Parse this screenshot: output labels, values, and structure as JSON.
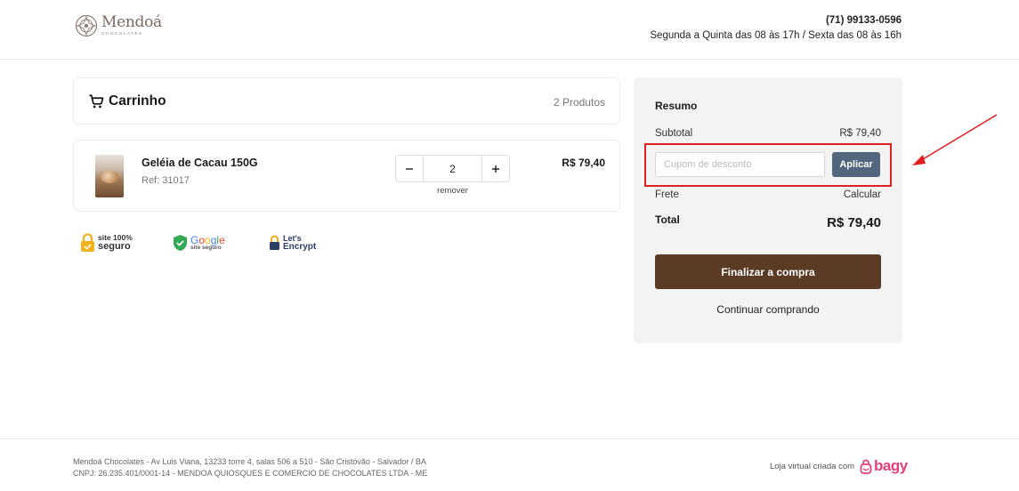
{
  "header": {
    "logo_name": "Mendoá",
    "logo_sub": "CHOCOLATES",
    "phone": "(71) 99133-0596",
    "hours": "Segunda a Quinta das 08 às 17h / Sexta das 08 às 16h"
  },
  "cart": {
    "title": "Carrinho",
    "count": "2 Produtos",
    "items": [
      {
        "name": "Geléia de Cacau 150G",
        "ref": "Ref: 31017",
        "quantity": "2",
        "remove_label": "remover",
        "price": "R$ 79,40"
      }
    ],
    "seals": [
      {
        "line1": "site 100%",
        "line2": "seguro"
      },
      {
        "line1": "Google",
        "line2": "site seguro"
      },
      {
        "line1": "Let's",
        "line2": "Encrypt"
      }
    ]
  },
  "summary": {
    "title": "Resumo",
    "subtotal_label": "Subtotal",
    "subtotal_value": "R$ 79,40",
    "coupon_placeholder": "Cupom de desconto",
    "apply_label": "Aplicar",
    "shipping_label": "Frete",
    "shipping_action": "Calcular",
    "total_label": "Total",
    "total_value": "R$ 79,40",
    "checkout_label": "Finalizar a compra",
    "continue_label": "Continuar comprando"
  },
  "footer": {
    "address": "Mendoá Chocolates - Av Luis Viana, 13233 torre 4, salas 506 a 510 - São Cristóvão - Salvador / BA",
    "company": "CNPJ: 26.235.401/0001-14 - MENDOA QUIOSQUES E COMERCIO DE CHOCOLATES LTDA - ME",
    "made_by": "Loja virtual criada com",
    "platform": "bagy"
  },
  "colors": {
    "checkout": "#5b3a26",
    "apply": "#52667d",
    "highlight": "#e02020",
    "bagy": "#e2407a"
  }
}
